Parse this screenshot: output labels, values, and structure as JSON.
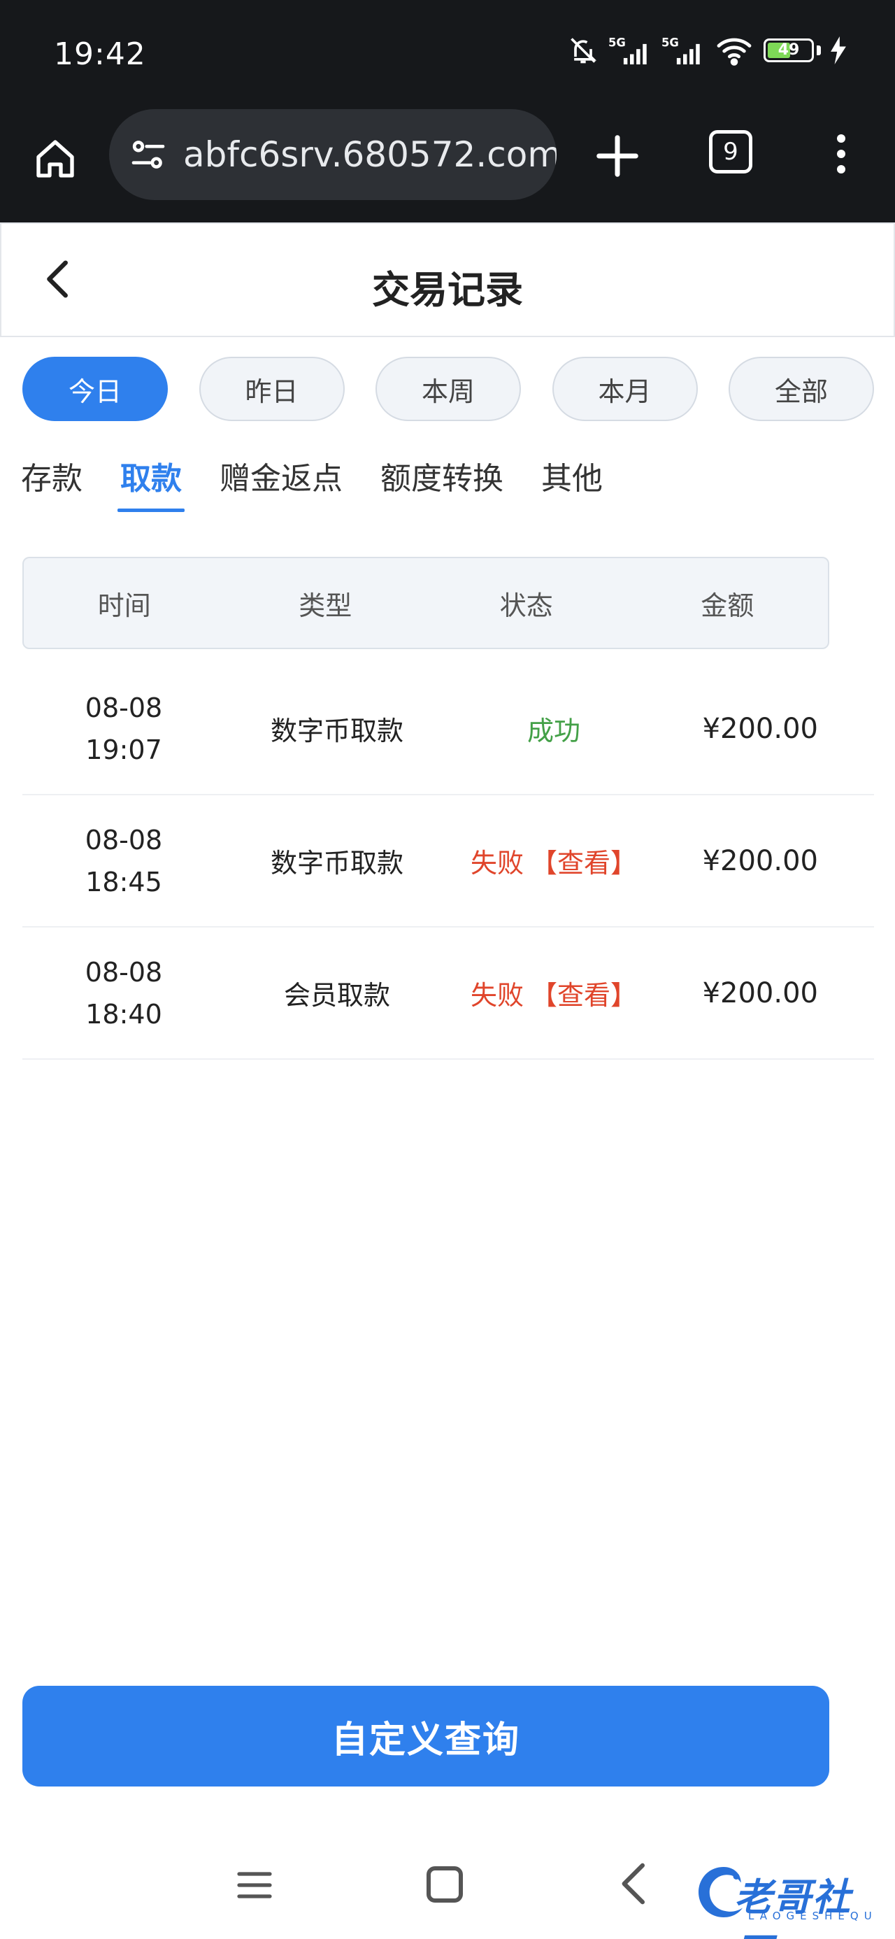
{
  "status_bar": {
    "time": "19:42",
    "battery": "49",
    "battery_level_percent": 49,
    "icons": [
      "bell-off-icon",
      "signal-5g-icon",
      "signal-5g-icon",
      "wifi-icon",
      "battery-icon",
      "charging-icon"
    ]
  },
  "browser": {
    "url": "abfc6srv.680572.com/",
    "tab_count": "9",
    "icons": [
      "home-icon",
      "site-settings-icon",
      "new-tab-icon",
      "tabs-icon",
      "more-icon"
    ]
  },
  "header": {
    "title": "交易记录"
  },
  "periods": [
    {
      "label": "今日",
      "active": true
    },
    {
      "label": "昨日",
      "active": false
    },
    {
      "label": "本周",
      "active": false
    },
    {
      "label": "本月",
      "active": false
    },
    {
      "label": "全部",
      "active": false
    }
  ],
  "categories": [
    {
      "label": "存款",
      "active": false
    },
    {
      "label": "取款",
      "active": true
    },
    {
      "label": "赠金返点",
      "active": false
    },
    {
      "label": "额度转换",
      "active": false
    },
    {
      "label": "其他",
      "active": false
    }
  ],
  "table": {
    "headers": [
      "时间",
      "类型",
      "状态",
      "金额"
    ],
    "rows": [
      {
        "date": "08-08",
        "time": "19:07",
        "type": "数字币取款",
        "status": "成功",
        "link": "",
        "amount": "¥200.00"
      },
      {
        "date": "08-08",
        "time": "18:45",
        "type": "数字币取款",
        "status": "失败",
        "link": "【查看】",
        "amount": "¥200.00"
      },
      {
        "date": "08-08",
        "time": "18:40",
        "type": "会员取款",
        "status": "失败",
        "link": "【查看】",
        "amount": "¥200.00"
      }
    ]
  },
  "query_button": {
    "label": "自定义查询"
  },
  "colors": {
    "accent": "#2f80ed",
    "success": "#43a047",
    "fail": "#e0452b",
    "browser_bg": "#16181b"
  },
  "watermark": {
    "text": "老哥社区",
    "sub": "LAOGESHEQU"
  }
}
